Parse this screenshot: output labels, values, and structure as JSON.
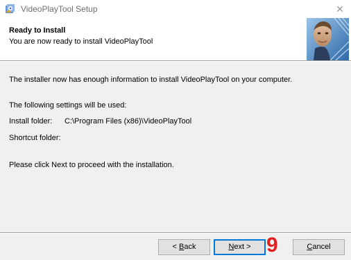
{
  "window": {
    "title": "VideoPlayTool Setup",
    "close_glyph": "✕",
    "icon": "installer-icon"
  },
  "header": {
    "title": "Ready to Install",
    "subtitle": "You are now ready to install VideoPlayTool",
    "banner_image": "installer-banner-image"
  },
  "body": {
    "info_line": "The installer now has enough information to install VideoPlayTool on your computer.",
    "settings_line": "The following settings will be used:",
    "install_folder_label": "Install folder:",
    "install_folder_value": "C:\\Program Files (x86)\\VideoPlayTool",
    "shortcut_folder_label": "Shortcut folder:",
    "proceed_line": "Please click Next to proceed with the installation."
  },
  "footer": {
    "back_prefix": "< ",
    "back_accel": "B",
    "back_rest": "ack",
    "next_accel": "N",
    "next_rest": "ext >",
    "cancel_accel": "C",
    "cancel_rest": "ancel",
    "step_number": "9"
  },
  "colors": {
    "accent": "#0078d7",
    "step_badge": "#e02020",
    "panel": "#f0f0f0"
  }
}
